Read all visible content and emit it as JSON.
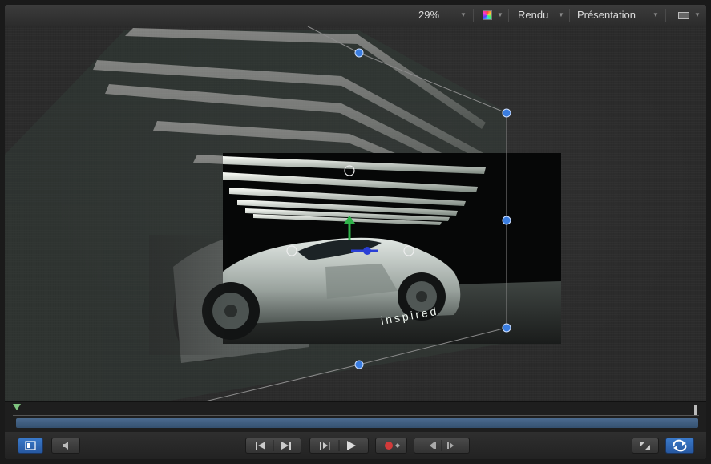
{
  "toolbar": {
    "zoom_label": "29%",
    "render_label": "Rendu",
    "view_label": "Présentation",
    "color_channel_icon": "color-channels-icon",
    "layout_icon": "view-layout-icon"
  },
  "canvas": {
    "overlay_text": "inspired",
    "handle_color": "#3a7de0",
    "axis_y_color": "#2fb24a",
    "axis_z_color": "#2a3fd6"
  },
  "transport": {
    "buttons": [
      "toggle-sidebar-icon",
      "audio-mute-icon",
      "go-to-start-icon",
      "go-to-end-icon",
      "play-range-icon",
      "play-icon",
      "record-icon",
      "step-backward-icon",
      "step-forward-icon",
      "fit-canvas-icon",
      "loop-icon"
    ]
  }
}
